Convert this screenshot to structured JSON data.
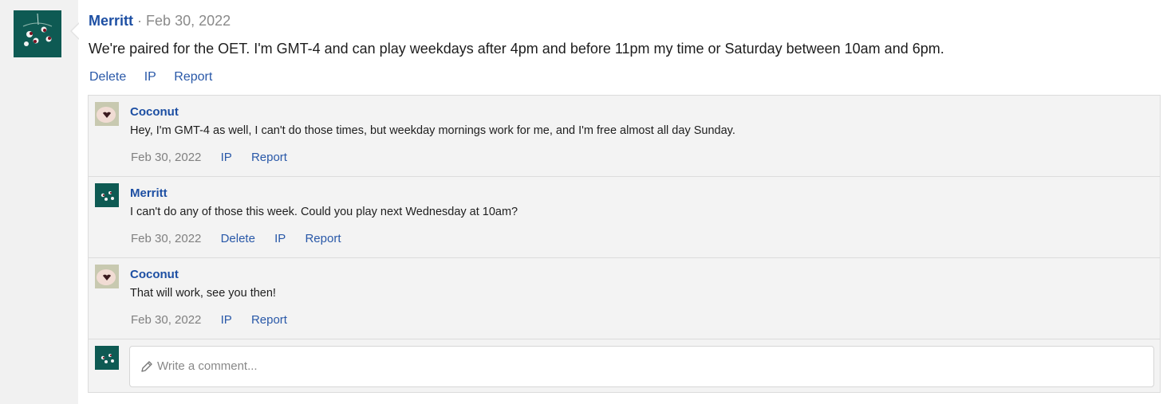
{
  "post": {
    "author": "Merritt",
    "separator": "·",
    "date": "Feb 30, 2022",
    "body": "We're paired for the OET. I'm GMT-4 and can play weekdays after 4pm and before 11pm my time or Saturday between 10am and 6pm.",
    "actions": {
      "delete": "Delete",
      "ip": "IP",
      "report": "Report"
    },
    "avatar_icon": "merritt-avatar-icon"
  },
  "comments": [
    {
      "author": "Coconut",
      "text": "Hey, I'm GMT-4 as well, I can't do those times, but weekday mornings work for me, and I'm free almost all day Sunday.",
      "date": "Feb 30, 2022",
      "actions": {
        "ip": "IP",
        "report": "Report"
      }
    },
    {
      "author": "Merritt",
      "text": "I can't do any of those this week. Could you play next Wednesday at 10am?",
      "date": "Feb 30, 2022",
      "actions": {
        "delete": "Delete",
        "ip": "IP",
        "report": "Report"
      }
    },
    {
      "author": "Coconut",
      "text": "That will work, see you then!",
      "date": "Feb 30, 2022",
      "actions": {
        "ip": "IP",
        "report": "Report"
      }
    }
  ],
  "composer": {
    "placeholder": "Write a comment...",
    "icon": "pencil-icon"
  },
  "colors": {
    "link": "#2958a8",
    "author": "#1d4fa3",
    "avatar_teal": "#0e5a53",
    "comments_bg": "#f3f3f3"
  }
}
